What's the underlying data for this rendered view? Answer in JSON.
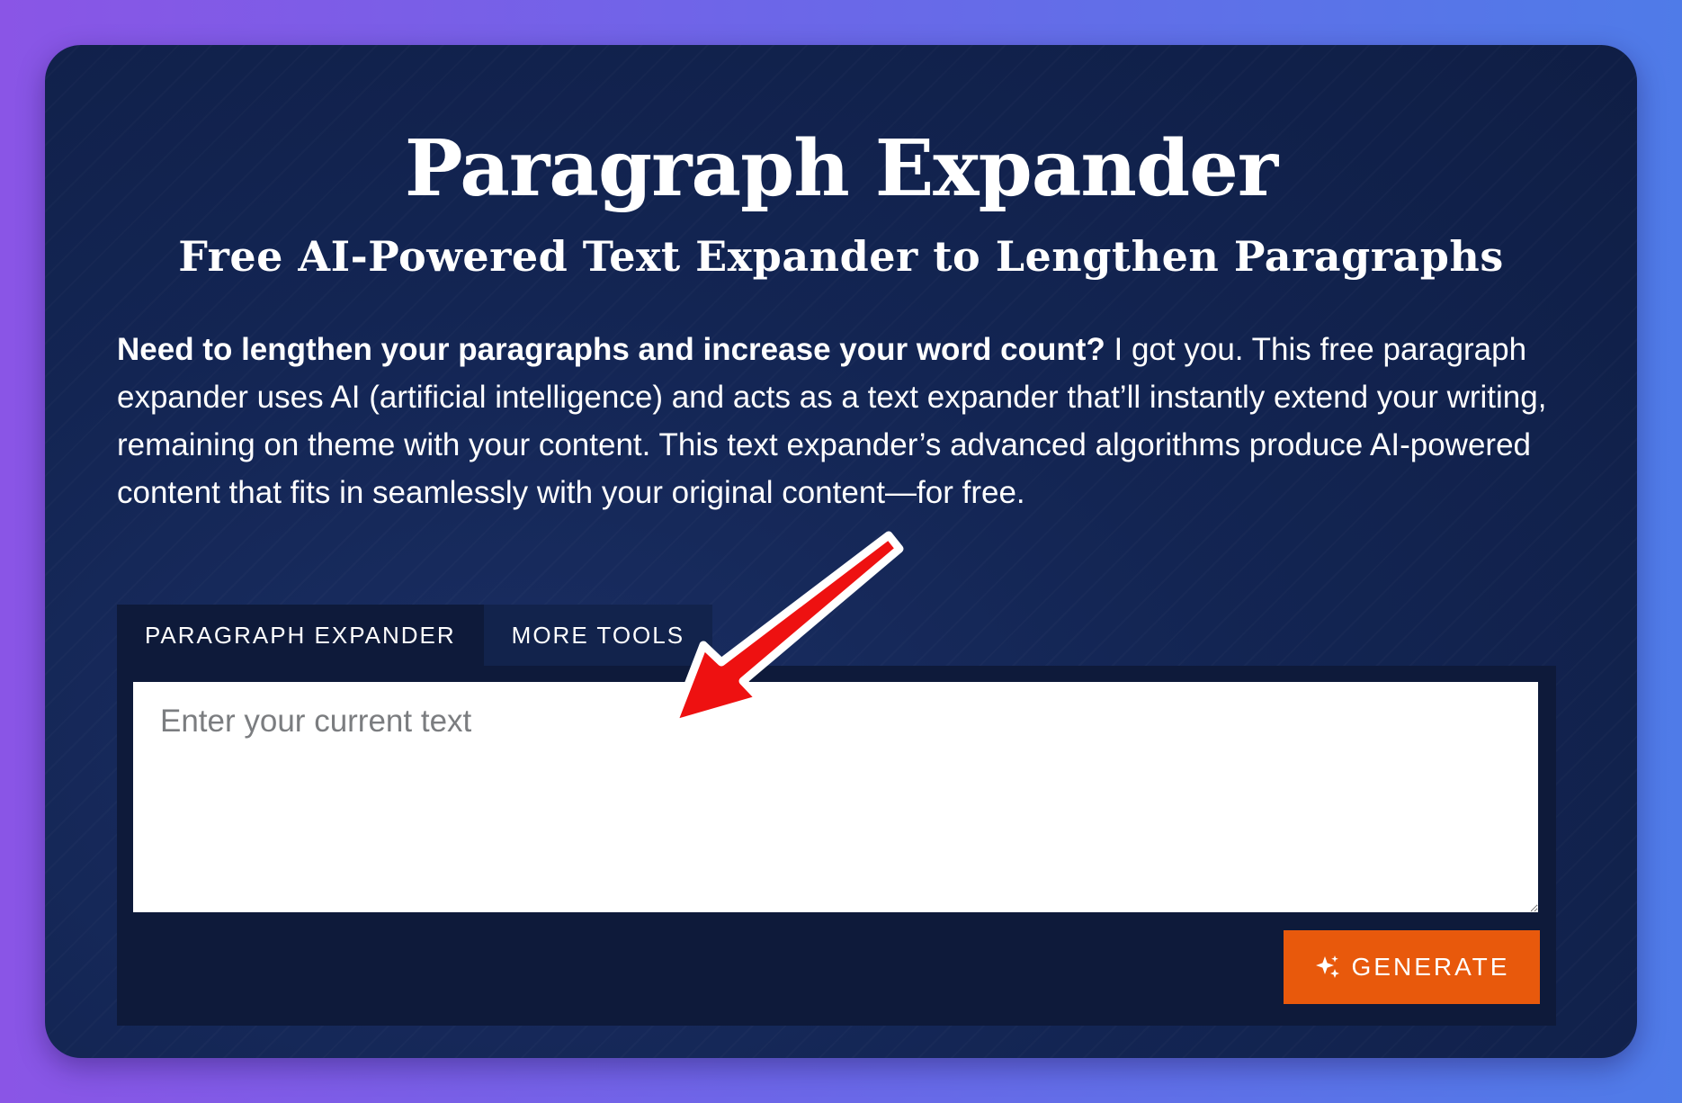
{
  "header": {
    "title": "Paragraph Expander",
    "subtitle": "Free AI-Powered Text Expander to Lengthen Paragraphs"
  },
  "intro": {
    "bold_text": "Need to lengthen your paragraphs and increase your word count?",
    "body_text": " I got you. This free paragraph expander uses AI (artificial intelligence) and acts as a text expander that’ll instantly extend your writing, remaining on theme with your content. This text expander’s advanced algorithms produce AI-powered content that fits in seamlessly with your original content—for free."
  },
  "tabs": [
    {
      "label": "PARAGRAPH EXPANDER",
      "active": true
    },
    {
      "label": "MORE TOOLS",
      "active": false
    }
  ],
  "input": {
    "placeholder": "Enter your current text",
    "value": ""
  },
  "generate_button": {
    "label": "GENERATE",
    "icon": "sparkle-icon"
  },
  "annotation": {
    "icon": "red-arrow-icon",
    "color": "#ee1111"
  },
  "colors": {
    "accent": "#e8590c",
    "card_background": "#132553",
    "panel_background": "#0e1a3a"
  }
}
